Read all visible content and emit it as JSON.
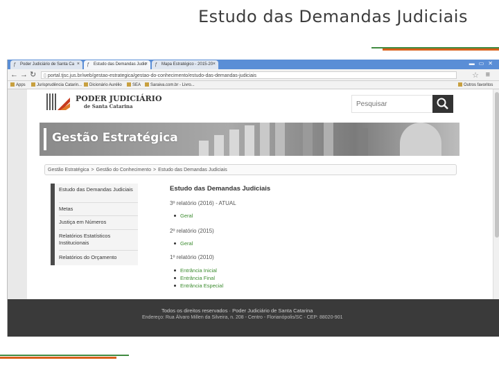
{
  "slide": {
    "title": "Estudo das Demandas Judiciais",
    "accent_green": "#3f8a3f",
    "accent_orange": "#d9601a"
  },
  "browser": {
    "tabs": [
      {
        "label": "Poder Judiciário de Santa Ca",
        "active": false
      },
      {
        "label": "Estudo das Demandas Judic",
        "active": true
      },
      {
        "label": "Mapa Estratégico - 2015-20",
        "active": false
      }
    ],
    "url": "portal.tjsc.jus.br/web/gestao-estrategica/gestao-do-conhecimento/estudo-das-demandas-judiciais",
    "bookmarks": [
      "Apps",
      "Jurisprudência Catarin...",
      "Dicionário Aurélio",
      "SEA",
      "Saraiva.com.br - Livro...",
      "Outros favoritos"
    ]
  },
  "site": {
    "logo_line1": "PODER JUDICIÁRIO",
    "logo_line2": "de Santa Catarina",
    "search_placeholder": "Pesquisar",
    "banner_title": "Gestão Estratégica",
    "breadcrumb": [
      "Gestão Estratégica",
      "Gestão do Conhecimento",
      "Estudo das Demandas Judiciais"
    ],
    "breadcrumb_sep": ">",
    "sidebar": [
      "Estudo das Demandas Judiciais",
      "Metas",
      "Justiça em Números",
      "Relatórios Estatísticos Institucionais",
      "Relatórios do Orçamento"
    ],
    "content": {
      "title": "Estudo das Demandas Judiciais",
      "reports": [
        {
          "heading": "3º relatório (2016) - ATUAL",
          "links": [
            "Geral"
          ]
        },
        {
          "heading": "2º relatório (2015)",
          "links": [
            "Geral"
          ]
        },
        {
          "heading": "1º relatório (2010)",
          "links": [
            "Entrância Inicial",
            "Entrância Final",
            "Entrância Especial"
          ]
        }
      ]
    },
    "footer": {
      "line1": "Todos os direitos reservados  ·  Poder Judiciário de Santa Catarina",
      "line2": "Endereço: Rua Álvaro Millen da Silveira, n. 208 - Centro - Florianópolis/SC - CEP: 88020-901"
    }
  }
}
